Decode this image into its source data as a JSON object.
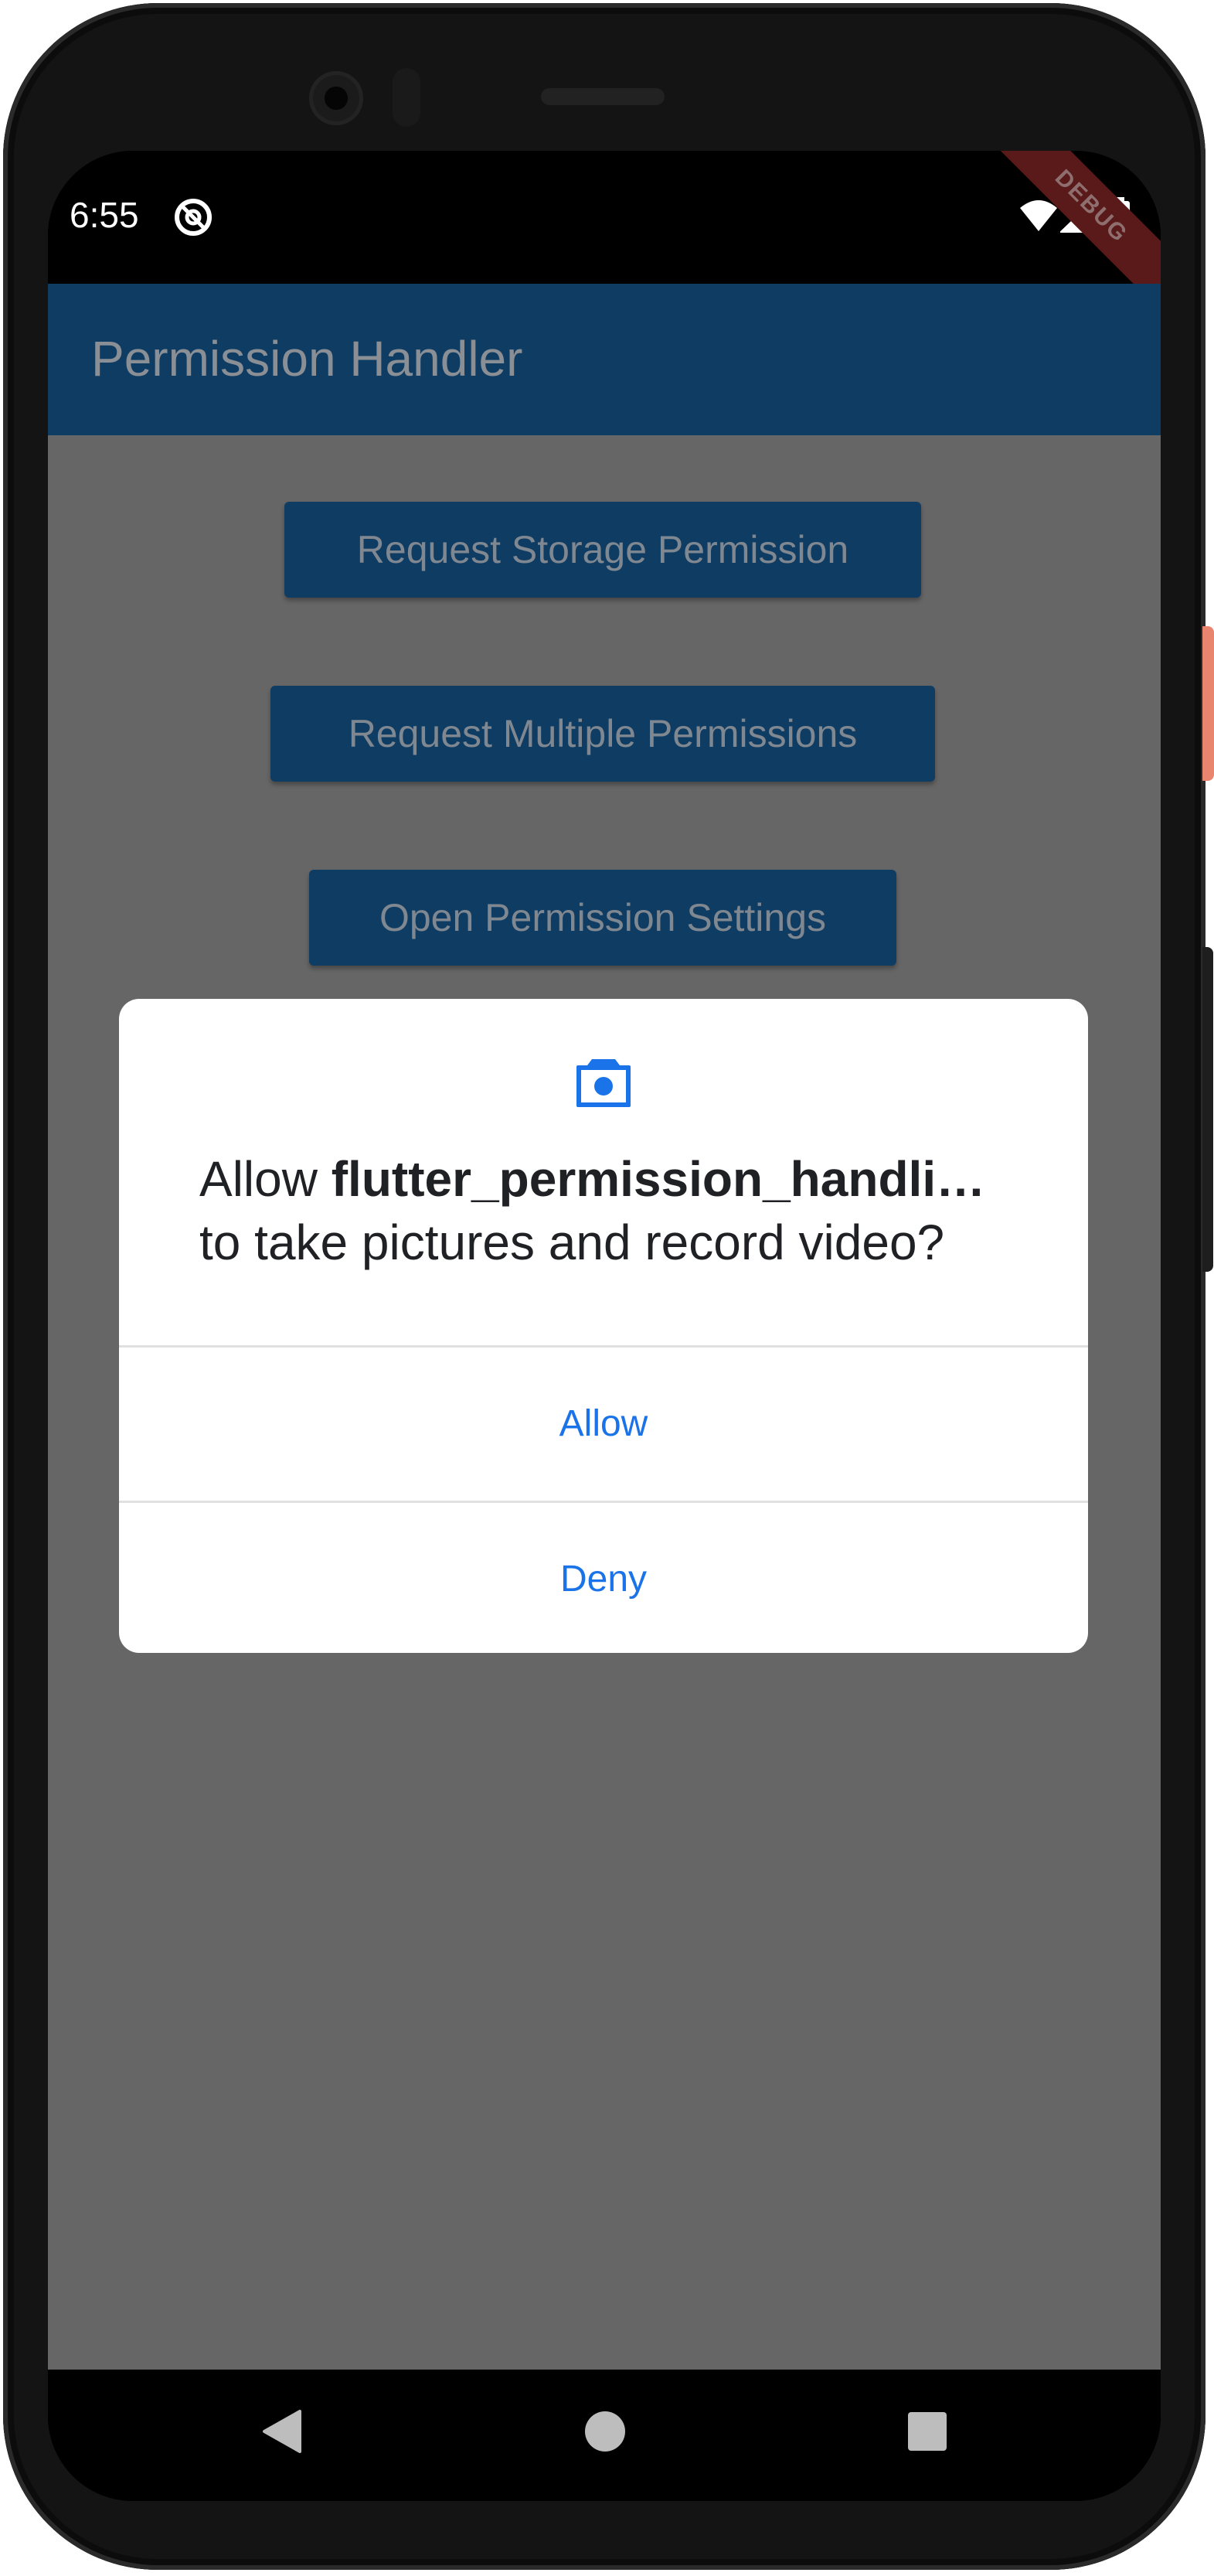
{
  "status_bar": {
    "time": "6:55",
    "debug_label": "DEBUG",
    "icons": [
      "at-sign-icon",
      "wifi-icon",
      "cellular-signal-icon",
      "battery-icon"
    ]
  },
  "app_bar": {
    "title": "Permission Handler"
  },
  "buttons": {
    "storage": "Request Storage Permission",
    "multiple": "Request Multiple Permissions",
    "settings": "Open Permission Settings"
  },
  "dialog": {
    "icon": "camera-icon",
    "message_prefix": "Allow ",
    "app_name": "flutter_permission_handli…",
    "message_suffix": "to take pictures and record video?",
    "allow_label": "Allow",
    "deny_label": "Deny"
  },
  "nav_bar": {
    "icons": [
      "back-icon",
      "home-icon",
      "recents-icon"
    ]
  },
  "colors": {
    "app_bar": "#0f3c63",
    "scrim": "#666666",
    "dialog_action": "#1a73e8",
    "debug_ribbon": "#5a1a1a"
  }
}
